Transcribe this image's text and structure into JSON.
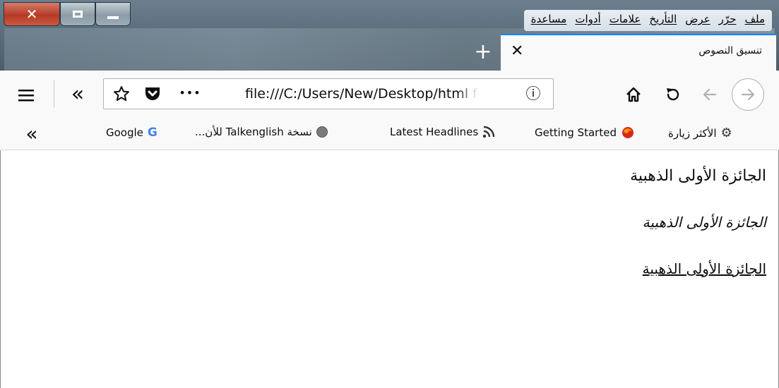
{
  "window": {
    "menu": [
      "ملف",
      "حرّر",
      "عرض",
      "التأريخ",
      "علامات",
      "أدوات",
      "مساعدة"
    ]
  },
  "tab": {
    "title": "تنسيق النصوص",
    "close_glyph": "✕",
    "newtab_glyph": "+"
  },
  "navbar": {
    "url": "file:///C:/Users/New/Desktop/html fi",
    "page_actions_glyph": "•••",
    "info_glyph": "ⓘ",
    "overflow_glyph": "«"
  },
  "bookmarks": {
    "items": [
      {
        "label": "الأكثر زيارة",
        "icon": "gear-icon"
      },
      {
        "label": "Getting Started",
        "icon": "firefox-icon"
      },
      {
        "label": "Latest Headlines",
        "icon": "rss-icon"
      },
      {
        "label": "نسخة Talkenglish للأن...",
        "icon": "globe-icon"
      },
      {
        "label": "Google",
        "icon": "google-icon"
      }
    ],
    "overflow_glyph": "«"
  },
  "content": {
    "line1": "الجائزة الأولى الذهبية",
    "line2": "الجائزة الأولى الذهبية",
    "line3": "الجائزة الأولى الذهبية"
  },
  "colors": {
    "accent": "#0a84ff",
    "close_button": "#c0402a"
  }
}
